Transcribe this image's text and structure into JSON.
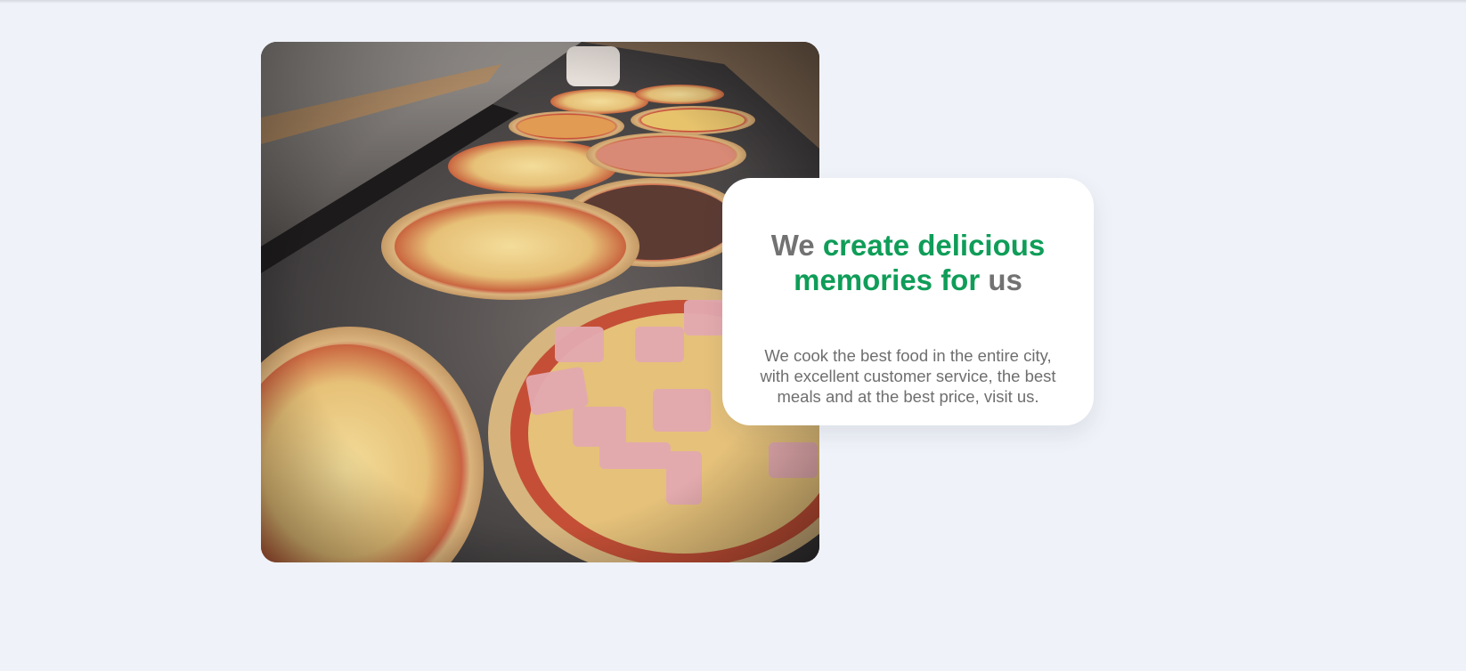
{
  "hero": {
    "image_alt": "Pizzas topped with cheese, ham and vegetables on a counter",
    "heading": {
      "part1": "We",
      "part2": "create delicious",
      "part3": "memories for",
      "part4": "us"
    },
    "description": "We cook the best food in the entire city, with excellent customer service, the best meals and at the best price, visit us."
  },
  "colors": {
    "background": "#eff2f8",
    "accent": "#0f9d58",
    "heading_gray": "#727272",
    "text_gray": "#6e6e6e",
    "card": "#ffffff"
  }
}
